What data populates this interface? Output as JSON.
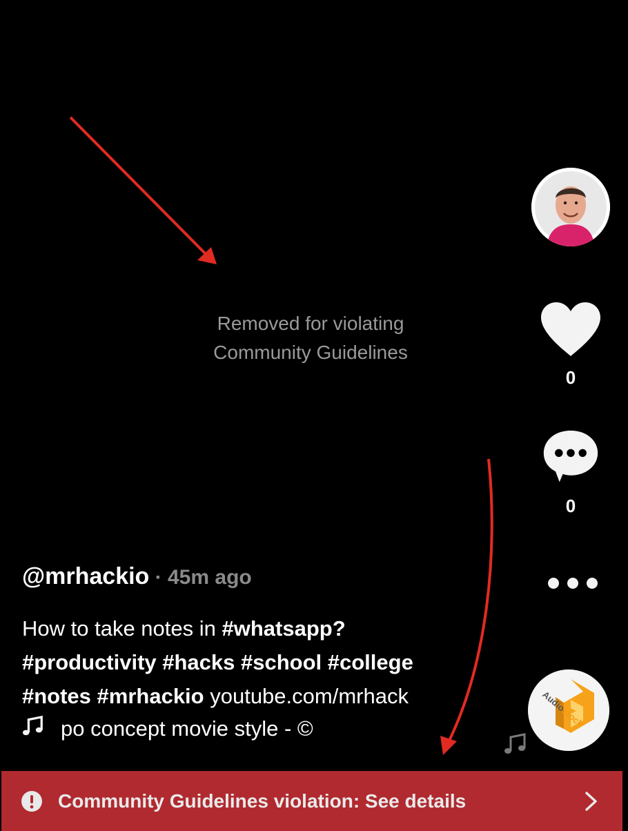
{
  "video": {
    "removed_line1": "Removed for violating",
    "removed_line2": "Community Guidelines"
  },
  "author": {
    "handle": "@mrhackio",
    "separator": " · ",
    "time_ago": "45m ago"
  },
  "description": {
    "line1_text": "How to take notes in ",
    "line1_tag": "#whatsapp?",
    "line2": "#productivity #hacks #school #college",
    "line3_tags": "#notes #mrhackio",
    "line3_link": " youtube.com/mrhack"
  },
  "sound": {
    "title": "po concept movie style - ©"
  },
  "actions": {
    "likes": "0",
    "comments": "0"
  },
  "disc_logo_text": "Audiostock",
  "banner": {
    "label": "Community Guidelines violation: See details"
  },
  "colors": {
    "banner_bg": "#b02a2f",
    "annotation_arrow": "#e12b22",
    "muted_text": "#9a9a9a"
  }
}
